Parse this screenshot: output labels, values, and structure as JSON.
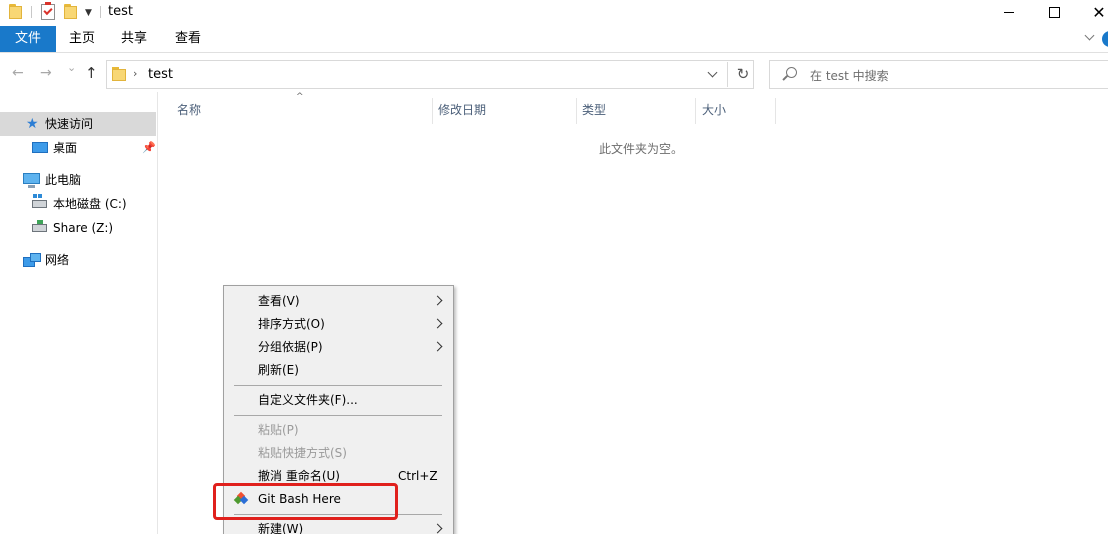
{
  "window": {
    "title": "test",
    "close_glyph": "✕"
  },
  "ribbon": {
    "tabs": [
      "文件",
      "主页",
      "共享",
      "查看"
    ]
  },
  "nav": {
    "back_glyph": "←",
    "forward_glyph": "→",
    "recent_glyph": "⌄",
    "up_glyph": "↑",
    "breadcrumb_sep": "›",
    "address": "test",
    "refresh_glyph": "↻",
    "search_placeholder": "在 test 中搜索"
  },
  "sidebar": {
    "items": [
      {
        "label": "快速访问",
        "icon": "star-icon",
        "selected": true
      },
      {
        "label": "桌面",
        "icon": "desktop-icon",
        "pinned": true
      },
      {
        "label": "此电脑",
        "icon": "pc-icon"
      },
      {
        "label": "本地磁盘 (C:)",
        "icon": "drive-icon"
      },
      {
        "label": "Share (Z:)",
        "icon": "network-drive-icon"
      },
      {
        "label": "网络",
        "icon": "network-icon"
      }
    ],
    "star_glyph": "★",
    "pin_glyph": "📌"
  },
  "columns": {
    "name": "名称",
    "modified": "修改日期",
    "type": "类型",
    "size": "大小",
    "sort_glyph": "^"
  },
  "content": {
    "empty_message": "此文件夹为空。"
  },
  "context_menu": {
    "items": [
      {
        "label": "查看(V)",
        "submenu": true
      },
      {
        "label": "排序方式(O)",
        "submenu": true
      },
      {
        "label": "分组依据(P)",
        "submenu": true
      },
      {
        "label": "刷新(E)"
      },
      {
        "label": "自定义文件夹(F)..."
      },
      {
        "label": "粘贴(P)",
        "disabled": true
      },
      {
        "label": "粘贴快捷方式(S)",
        "disabled": true
      },
      {
        "label": "撤消 重命名(U)",
        "accelerator": "Ctrl+Z"
      },
      {
        "label": "Git Bash Here",
        "icon": "git-icon",
        "highlighted": true
      },
      {
        "label": "新建(W)",
        "submenu": true
      }
    ]
  },
  "colors": {
    "accent": "#1979ca",
    "highlight": "#e0201c",
    "menu_bg": "#f0f0f0"
  }
}
